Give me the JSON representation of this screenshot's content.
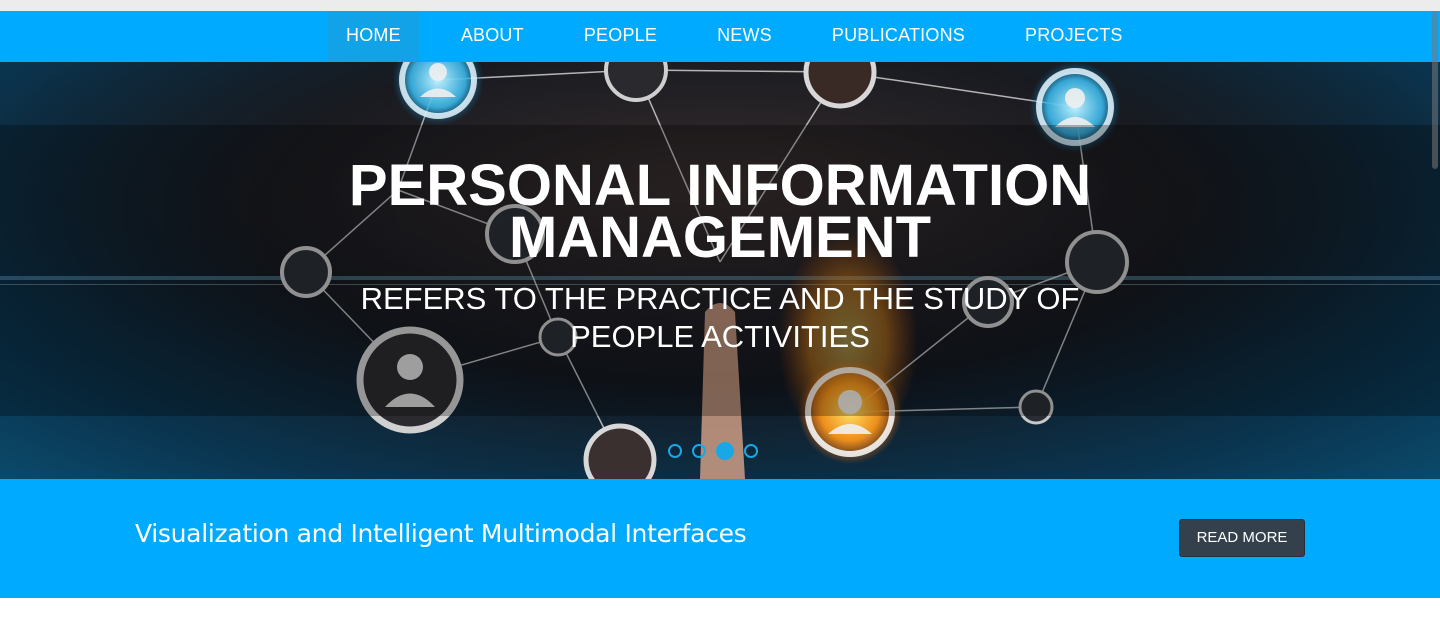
{
  "nav": {
    "items": [
      {
        "label": "HOME",
        "active": true
      },
      {
        "label": "ABOUT",
        "active": false
      },
      {
        "label": "PEOPLE",
        "active": false
      },
      {
        "label": "NEWS",
        "active": false
      },
      {
        "label": "PUBLICATIONS",
        "active": false
      },
      {
        "label": "PROJECTS",
        "active": false
      }
    ]
  },
  "hero": {
    "title": "PERSONAL INFORMATION MANAGEMENT",
    "subtitle": "REFERS TO THE PRACTICE AND THE STUDY OF PEOPLE ACTIVITIES",
    "slides_total": 4,
    "active_slide": 3
  },
  "promo": {
    "text": "Visualization and Intelligent Multimodal Interfaces",
    "button_label": "READ MORE"
  },
  "colors": {
    "nav_bg": "#00aaff",
    "promo_bg": "#00aaff",
    "button_bg": "#34404c",
    "accent": "#1aa7e6"
  }
}
